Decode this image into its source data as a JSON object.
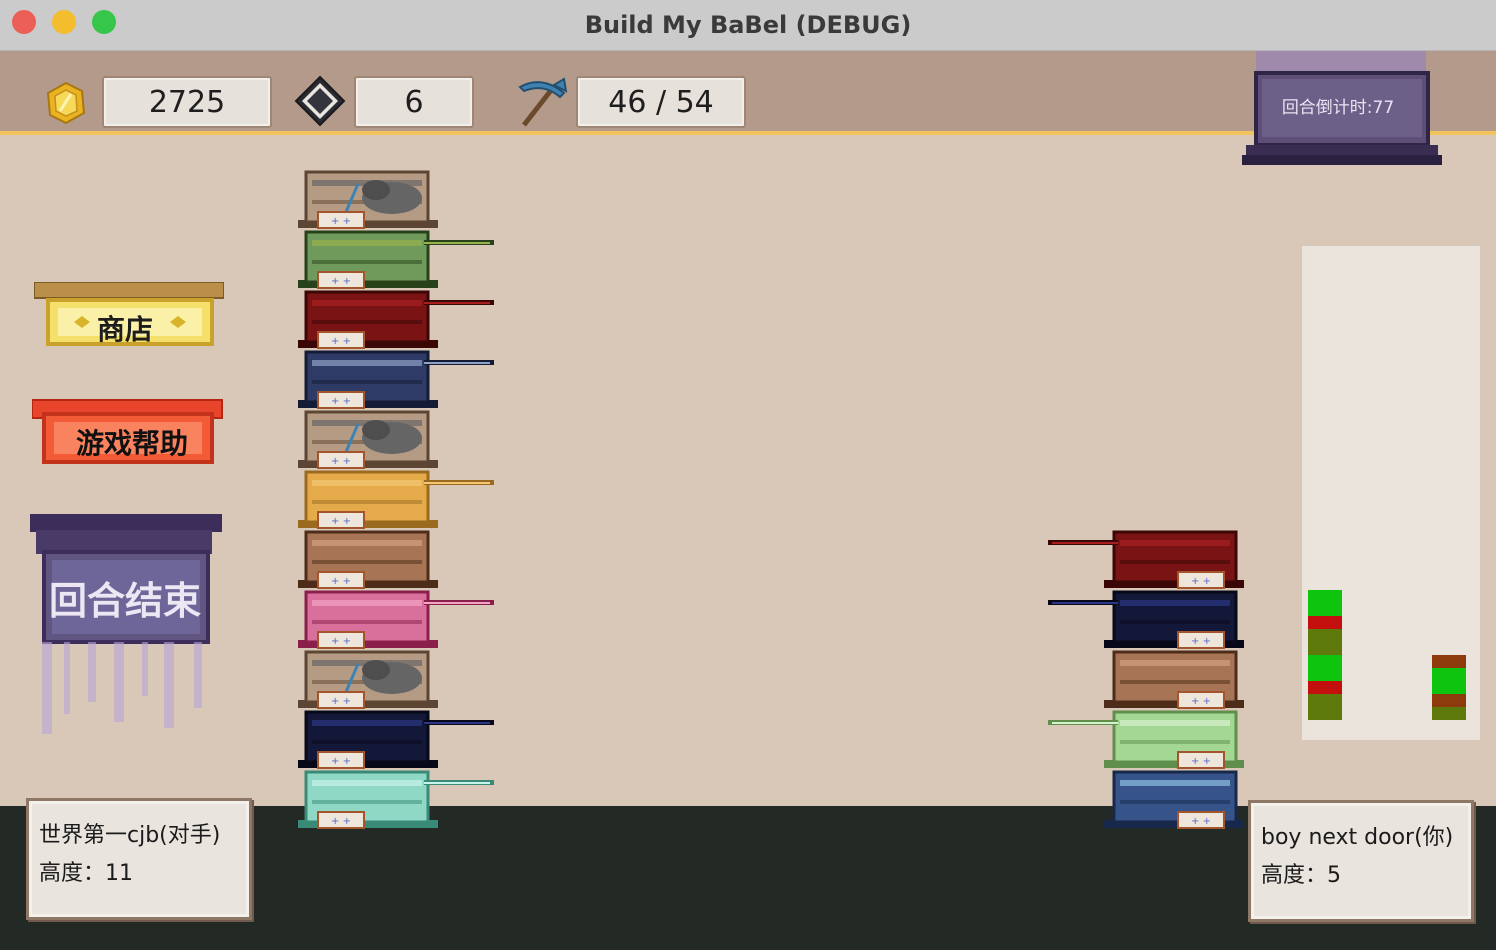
{
  "window": {
    "title": "Build My BaBel (DEBUG)"
  },
  "resources": {
    "coins": "2725",
    "gems": "6",
    "pickaxe": "46 / 54",
    "coin_icon": "gold-coin-icon",
    "gem_icon": "diamond-gem-icon",
    "pickaxe_icon": "pickaxe-icon"
  },
  "timer": {
    "label": "回合倒计时:77"
  },
  "buttons": {
    "shop": "商店",
    "help": "游戏帮助",
    "end_turn": "回合结束"
  },
  "opponent": {
    "name": "世界第一cjb(对手)",
    "height_label": "高度：11",
    "books": [
      "stone",
      "green",
      "crimson",
      "navy",
      "stone",
      "golden",
      "leather",
      "pink",
      "stone",
      "midnight",
      "crystal"
    ]
  },
  "player": {
    "name": "boy next door(你)",
    "height_label": "高度：5",
    "books": [
      "crimson",
      "midnight",
      "leather",
      "leaf",
      "slate"
    ]
  },
  "colors": {
    "background": "#d9c7b8",
    "topbar": "#b49a8a",
    "accent_line": "#f1c35c",
    "ground": "#232924",
    "bar_green": "#0fc40f",
    "bar_red": "#c40f0f",
    "bar_olive": "#5e7a0c",
    "bar_rust": "#8d3a0c"
  },
  "book_palette": {
    "stone": {
      "body": "#b59b83",
      "dark": "#5c4633",
      "accent": "#656565",
      "ext": false
    },
    "green": {
      "body": "#6f9a5c",
      "dark": "#27421a",
      "accent": "#98b14c",
      "ext": true
    },
    "crimson": {
      "body": "#7a1414",
      "dark": "#3a0606",
      "accent": "#a81f1f",
      "ext": true
    },
    "navy": {
      "body": "#2d3b66",
      "dark": "#131b35",
      "accent": "#8fa0c4",
      "ext": true
    },
    "golden": {
      "body": "#e5ab4a",
      "dark": "#9a6a1f",
      "accent": "#f3c774",
      "ext": true
    },
    "leather": {
      "body": "#a77555",
      "dark": "#4d2d1a",
      "accent": "#d1a183",
      "ext": false
    },
    "pink": {
      "body": "#d9709c",
      "dark": "#8a1f4b",
      "accent": "#f3a5c6",
      "ext": true
    },
    "midnight": {
      "body": "#141838",
      "dark": "#070919",
      "accent": "#2b3686",
      "ext": true
    },
    "crystal": {
      "body": "#8fd8c5",
      "dark": "#3a8a78",
      "accent": "#c7f3e9",
      "ext": true
    },
    "leaf": {
      "body": "#a5d794",
      "dark": "#5f8e4d",
      "accent": "#d6f1cc",
      "ext": true
    },
    "slate": {
      "body": "#37548a",
      "dark": "#18284a",
      "accent": "#8dbde0",
      "ext": false
    }
  },
  "height_chart": {
    "opponent_segments": [
      "olive",
      "olive",
      "red",
      "green",
      "green",
      "olive",
      "olive",
      "red",
      "green",
      "green"
    ],
    "player_segments": [
      "olive",
      "rust",
      "green",
      "green",
      "rust"
    ]
  }
}
